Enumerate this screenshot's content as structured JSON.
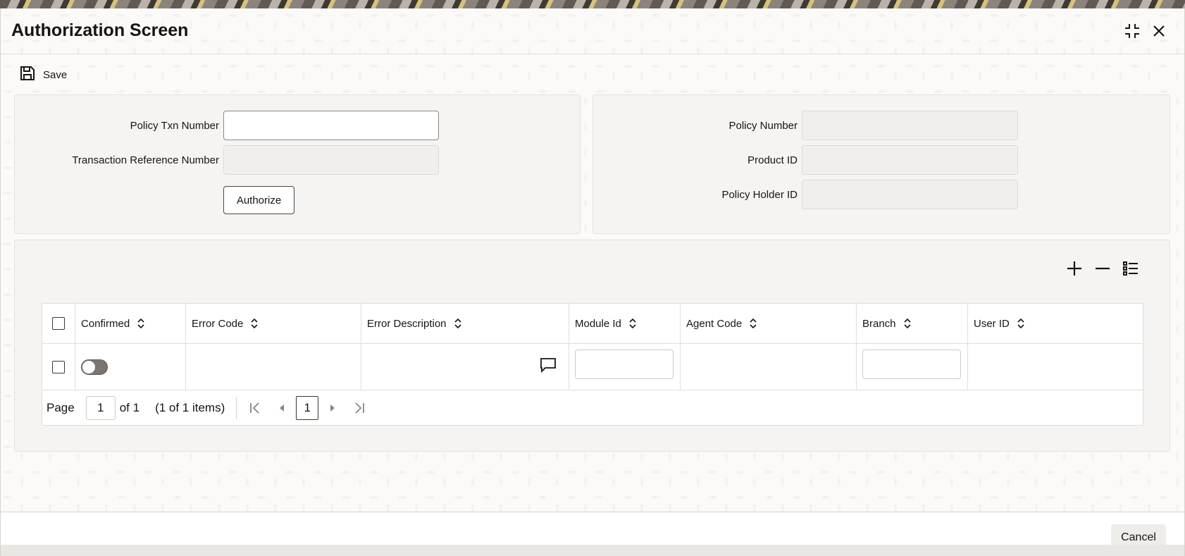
{
  "window": {
    "title": "Authorization Screen",
    "icons": [
      "collapse-icon",
      "close-icon"
    ]
  },
  "toolbar": {
    "save_label": "Save"
  },
  "left_panel": {
    "policy_txn_label": "Policy Txn Number",
    "policy_txn_value": "",
    "txn_ref_label": "Transaction Reference Number",
    "txn_ref_value": "",
    "authorize_label": "Authorize"
  },
  "right_panel": {
    "policy_number_label": "Policy Number",
    "policy_number_value": "",
    "product_id_label": "Product ID",
    "product_id_value": "",
    "policy_holder_label": "Policy Holder ID",
    "policy_holder_value": ""
  },
  "grid": {
    "actions": [
      "add-icon",
      "remove-icon",
      "list-view-icon"
    ],
    "columns": [
      "Confirmed",
      "Error Code",
      "Error Description",
      "Module Id",
      "Agent Code",
      "Branch",
      "User ID"
    ],
    "rows": [
      {
        "confirmed": false,
        "error_code": "",
        "error_description": "",
        "module_id": "",
        "agent_code": "",
        "branch": "",
        "user_id": ""
      }
    ],
    "pager": {
      "page_label": "Page",
      "page_value": "1",
      "of_label": "of 1",
      "items_label": "(1 of 1 items)",
      "current_page": "1"
    }
  },
  "footer": {
    "cancel_label": "Cancel"
  }
}
